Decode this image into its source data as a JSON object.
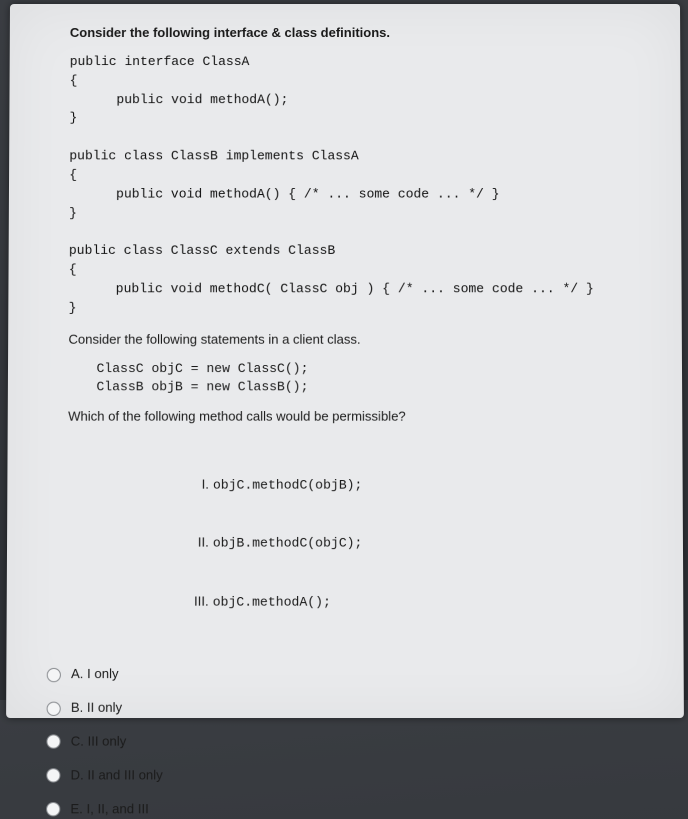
{
  "prompt_intro": "Consider the following interface & class definitions.",
  "code_block": "public interface ClassA\n{\n      public void methodA();\n}\n\npublic class ClassB implements ClassA\n{\n      public void methodA() { /* ... some code ... */ }\n}\n\npublic class ClassC extends ClassB\n{\n      public void methodC( ClassC obj ) { /* ... some code ... */ }\n}",
  "prompt_statements": "Consider the following statements in a client class.",
  "client_statements": "ClassC objC = new ClassC();\nClassB objB = new ClassB();",
  "question": "Which of the following method calls would be permissible?",
  "roman": {
    "i": {
      "num": "I.",
      "code": "objC.methodC(objB);"
    },
    "ii": {
      "num": "II.",
      "code": "objB.methodC(objC);"
    },
    "iii": {
      "num": "III.",
      "code": "objC.methodA();"
    }
  },
  "options": {
    "a": "A. I only",
    "b": "B. II only",
    "c": "C. III only",
    "d": "D. II and III only",
    "e": "E. I, II, and III"
  }
}
